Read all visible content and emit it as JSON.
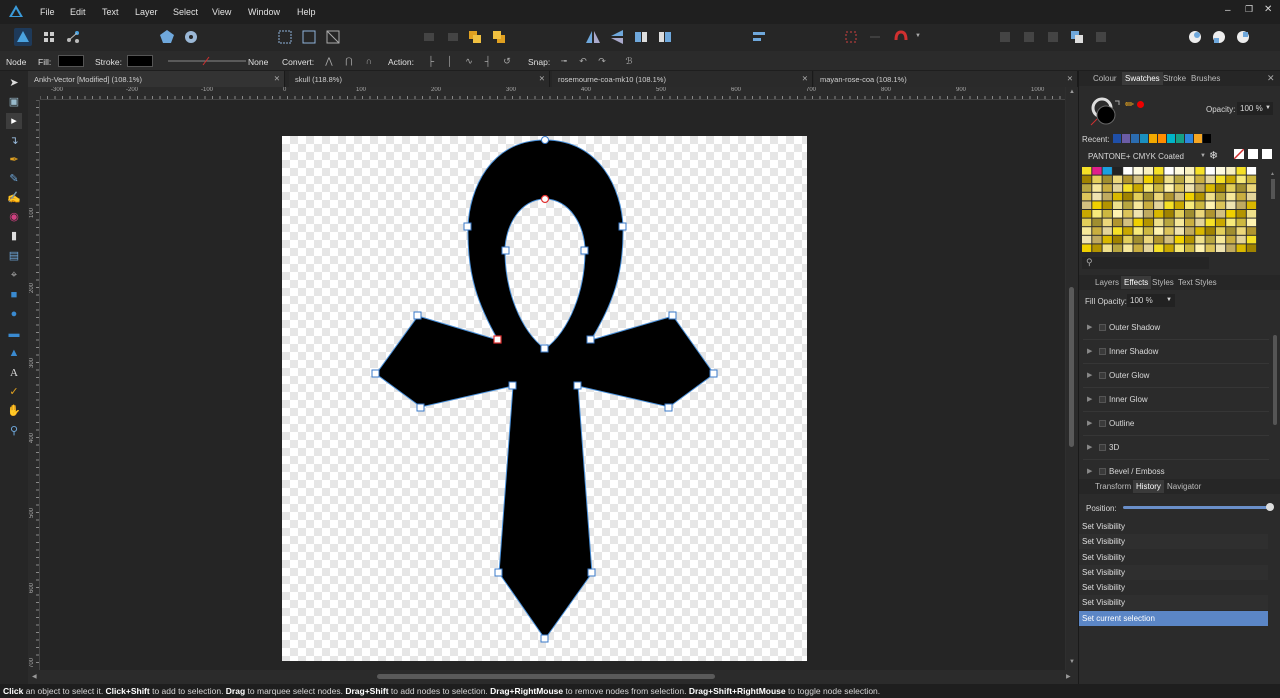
{
  "menu": [
    "File",
    "Edit",
    "Text",
    "Layer",
    "Select",
    "View",
    "Window",
    "Help"
  ],
  "context_bar": {
    "mode": "Node",
    "fill_label": "Fill:",
    "stroke_label": "Stroke:",
    "stroke_none": "None",
    "convert_label": "Convert:",
    "action_label": "Action:",
    "snap_label": "Snap:"
  },
  "tabs": [
    {
      "label": "Ankh-Vector [Modified] (108.1%)",
      "active": true
    },
    {
      "label": "skull (118.8%)",
      "active": false
    },
    {
      "label": "rosemourne-coa-mk10 (108.1%)",
      "active": false
    },
    {
      "label": "mayan-rose-coa (108.1%)",
      "active": false
    }
  ],
  "ruler_h": [
    "-300",
    "-200",
    "-100",
    "0",
    "100",
    "200",
    "300",
    "400",
    "500",
    "600",
    "700",
    "800",
    "900",
    "1000"
  ],
  "ruler_v": [
    "100",
    "200",
    "300",
    "400",
    "500",
    "600",
    "700"
  ],
  "right_panel": {
    "top_tabs": [
      "Colour",
      "Swatches",
      "Stroke",
      "Brushes"
    ],
    "opacity_label": "Opacity:",
    "opacity_value": "100 %",
    "recent_label": "Recent:",
    "palette_name": "PANTONE+ CMYK Coated",
    "effects_tabs": [
      "Layers",
      "Effects",
      "Styles",
      "Text Styles"
    ],
    "fill_opacity_label": "Fill Opacity:",
    "fill_opacity_value": "100 %",
    "effects": [
      "Outer Shadow",
      "Inner Shadow",
      "Outer Glow",
      "Inner Glow",
      "Outline",
      "3D",
      "Bevel / Emboss"
    ],
    "history_tabs": [
      "Transform",
      "History",
      "Navigator"
    ],
    "position_label": "Position:",
    "history": [
      "Set Visibility",
      "Set Visibility",
      "Set Visibility",
      "Set Visibility",
      "Set Visibility",
      "Set Visibility",
      "Set current selection"
    ]
  },
  "recent_colors": [
    "#1f4fa8",
    "#6b5ca5",
    "#2b6cb0",
    "#1a8fbf",
    "#f2a900",
    "#ff8c00",
    "#00b5c8",
    "#16a085",
    "#2e86de",
    "#f5a623",
    "#000000"
  ],
  "status": {
    "parts": [
      {
        "b": "Click",
        "t": " an object to select it. "
      },
      {
        "b": "Click+Shift",
        "t": " to add to selection. "
      },
      {
        "b": "Drag",
        "t": " to marquee select nodes. "
      },
      {
        "b": "Drag+Shift",
        "t": " to add nodes to selection. "
      },
      {
        "b": "Drag+RightMouse",
        "t": " to remove nodes from selection. "
      },
      {
        "b": "Drag+Shift+RightMouse",
        "t": " to toggle node selection."
      }
    ]
  },
  "colors": {
    "accent": "#5b86c6",
    "selection_blue": "#4a90d9",
    "node_red": "#e03030"
  }
}
